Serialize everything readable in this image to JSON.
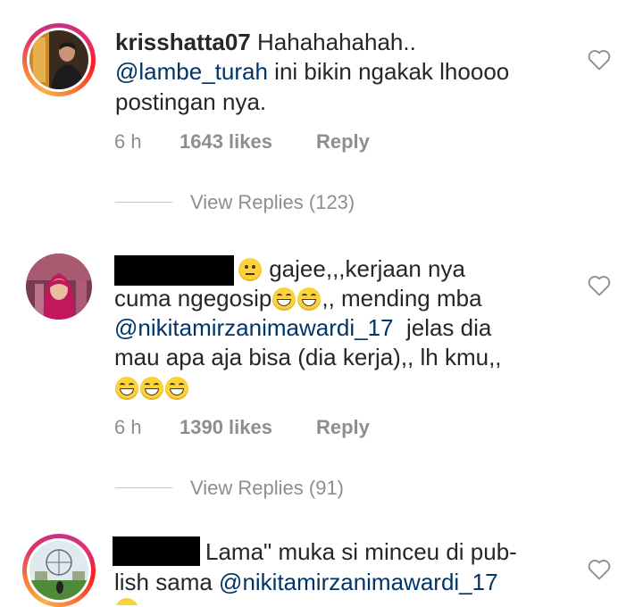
{
  "comments": [
    {
      "username": "krisshatta07",
      "line1_text": "Hahahahahah..",
      "line2_mention": "@lambe_turah",
      "line2_text": " ini bikin ngakak lhoooo",
      "line3_text": "postingan nya.",
      "time": "6 h",
      "likes": "1643 likes",
      "reply": "Reply",
      "view_replies": "View Replies (123)"
    },
    {
      "line1_text": " gajee,,,kerjaan nya",
      "line2_text_a": "cuma ngegosip",
      "line2_text_b": ",, mending mba",
      "line3_mention": "@nikitamirzanimawardi_17",
      "line3_text": "  jelas dia",
      "line4_text": "mau apa aja bisa (dia kerja),, lh kmu,,",
      "time": "6 h",
      "likes": "1390 likes",
      "reply": "Reply",
      "view_replies": "View Replies (91)"
    },
    {
      "line1_text": "Lama\" muka si minceu di pub-",
      "line2_text": "lish sama ",
      "line2_mention": "@nikitamirzanimawardi_17"
    }
  ],
  "icons": {
    "heart": "heart-outline-icon",
    "emoji_laugh": "grinning-squinting-face-icon",
    "emoji_neutral": "neutral-face-icon"
  },
  "colors": {
    "mention": "#003569",
    "meta": "#8e8e8e",
    "text": "#262626"
  }
}
